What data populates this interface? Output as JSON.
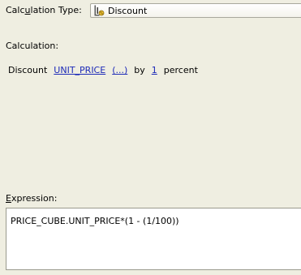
{
  "calc_type": {
    "label_pre": "Calc",
    "label_accel": "u",
    "label_post": "lation Type:",
    "selected": "Discount",
    "icon": "discount-calculation-icon"
  },
  "calculation": {
    "label": "Calculation:",
    "word_1": "Discount",
    "measure_link": "UNIT_PRICE",
    "more_link": "(...)",
    "word_2": "by",
    "amount_link": "1",
    "word_3": "percent"
  },
  "expression": {
    "label_accel": "E",
    "label_post": "xpression:",
    "value": "PRICE_CUBE.UNIT_PRICE*(1 - (1/100))"
  }
}
